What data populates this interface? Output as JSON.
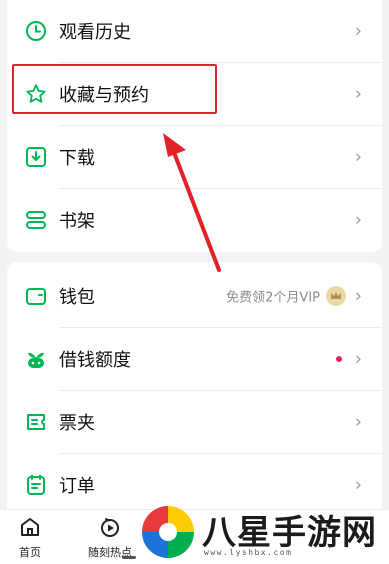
{
  "menu_group_1": [
    {
      "label": "观看历史",
      "icon": "clock-icon"
    },
    {
      "label": "收藏与预约",
      "icon": "star-icon"
    },
    {
      "label": "下载",
      "icon": "download-icon"
    },
    {
      "label": "书架",
      "icon": "bookshelf-icon"
    }
  ],
  "menu_group_2": [
    {
      "label": "钱包",
      "icon": "wallet-icon",
      "note": "免费领2个月VIP"
    },
    {
      "label": "借钱额度",
      "icon": "sprout-icon"
    },
    {
      "label": "票夹",
      "icon": "ticket-icon"
    },
    {
      "label": "订单",
      "icon": "order-icon"
    }
  ],
  "bottom_nav": [
    {
      "label": "首页",
      "icon": "home-icon"
    },
    {
      "label": "随刻热点",
      "icon": "play-circle-icon"
    }
  ],
  "watermark": {
    "title": "八星手游网",
    "url": "www.lyshbx.com"
  },
  "colors": {
    "accent": "#00b853",
    "highlight": "#e3212b",
    "dot": "#e91e63"
  }
}
